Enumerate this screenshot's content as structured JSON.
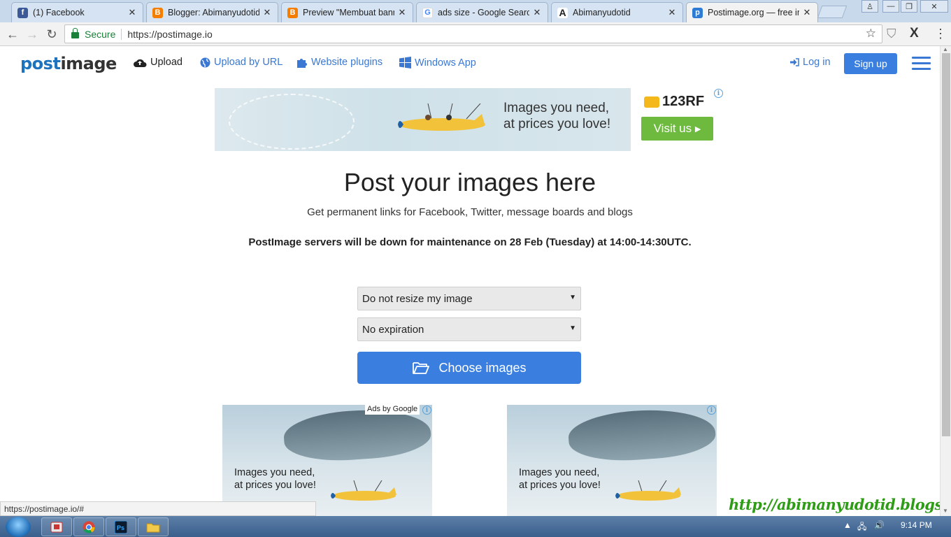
{
  "browser": {
    "tabs": [
      {
        "title": "(1) Facebook",
        "favicon": "facebook-icon",
        "color": "#3b5998",
        "glyph": "f"
      },
      {
        "title": "Blogger: Abimanyudotid",
        "favicon": "blogger-icon",
        "color": "#f57d00",
        "glyph": "B"
      },
      {
        "title": "Preview \"Membuat bann",
        "favicon": "blogger-icon",
        "color": "#f57d00",
        "glyph": "B"
      },
      {
        "title": "ads size - Google Search",
        "favicon": "google-icon",
        "color": "#4285f4",
        "glyph": "G"
      },
      {
        "title": "Abimanyudotid",
        "favicon": "abimanyu-icon",
        "color": "#222222",
        "glyph": "A"
      },
      {
        "title": "Postimage.org — free im",
        "favicon": "postimage-icon",
        "color": "#2e7bd6",
        "glyph": "p"
      }
    ],
    "secure_label": "Secure",
    "url": "https://postimage.io",
    "status_url": "https://postimage.io/#"
  },
  "header": {
    "logo_part1": "post",
    "logo_part2": "image",
    "nav": {
      "upload": "Upload",
      "upload_url": "Upload by URL",
      "plugins": "Website plugins",
      "windows_app": "Windows App",
      "login": "Log in",
      "signup": "Sign up"
    }
  },
  "top_ad": {
    "tagline_line1": "Images you need,",
    "tagline_line2": "at prices you love!",
    "brand": "123RF",
    "cta": "Visit us"
  },
  "main": {
    "title": "Post your images here",
    "subtitle": "Get permanent links for Facebook, Twitter, message boards and blogs",
    "notice": "PostImage servers will be down for maintenance on 28 Feb (Tuesday) at 14:00-14:30UTC.",
    "resize_select": "Do not resize my image",
    "expiration_select": "No expiration",
    "choose_button": "Choose images"
  },
  "bottom_ads": {
    "ads_by": "Ads by Google",
    "line1": "Images you need,",
    "line2": "at prices you love!"
  },
  "watermark": "http://abimanyudotid.blogspot.co.id/",
  "taskbar": {
    "clock": "9:14 PM"
  },
  "colors": {
    "brand_blue": "#3a7fe0",
    "link_blue": "#3a78d4",
    "secure_green": "#188038",
    "ad_green": "#6dba3f"
  }
}
